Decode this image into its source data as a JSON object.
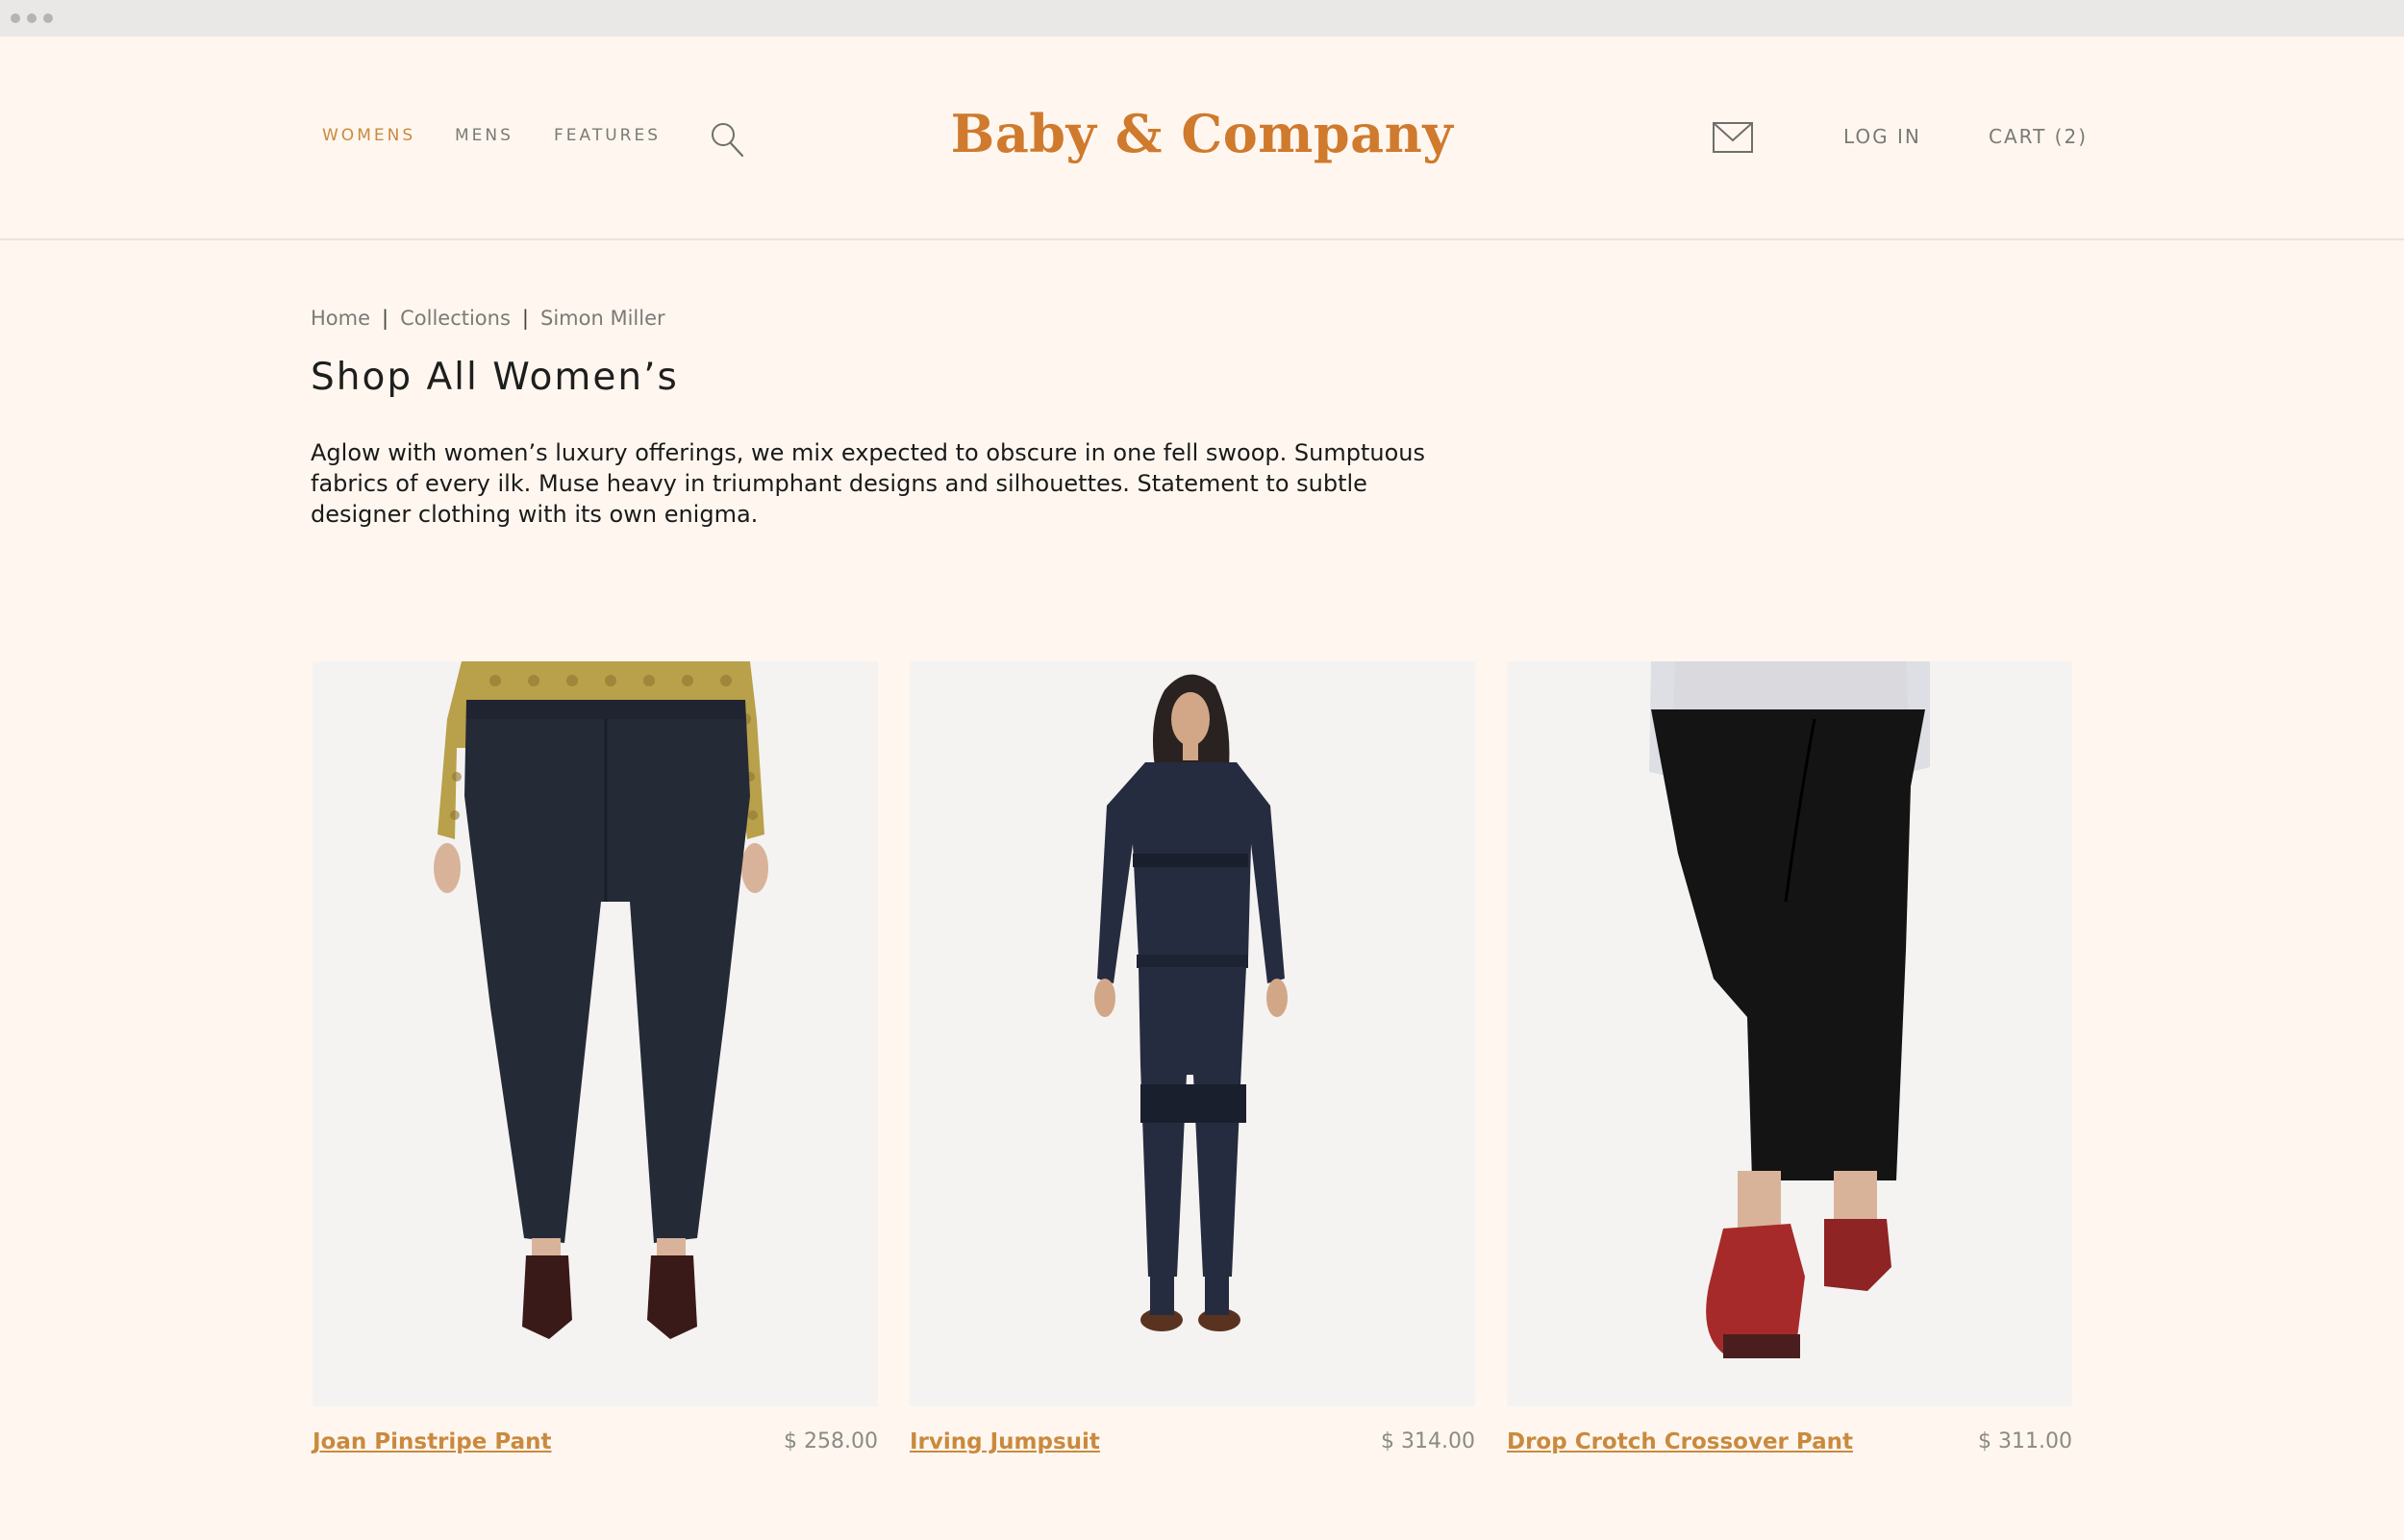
{
  "browser": {
    "controls": [
      "window-dot-icon",
      "window-dot-icon",
      "window-dot-icon"
    ]
  },
  "header": {
    "nav": [
      {
        "label": "WOMENS",
        "active": true
      },
      {
        "label": "MENS",
        "active": false
      },
      {
        "label": "FEATURES",
        "active": false
      }
    ],
    "search_icon": "search-icon",
    "logo": "Baby & Company",
    "mail_icon": "mail-icon",
    "login_label": "LOG IN",
    "cart_label": "CART (2)"
  },
  "breadcrumb": {
    "items": [
      "Home",
      "Collections",
      "Simon Miller"
    ],
    "separator": "|"
  },
  "page": {
    "title": "Shop All Women’s",
    "intro": "Aglow with women’s luxury offerings, we mix expected to obscure in one fell swoop. Sumptuous fabrics of every ilk. Muse heavy in triumphant designs and silhouettes. Statement to subtle designer clothing with its own enigma."
  },
  "products": [
    {
      "name": "Joan Pinstripe Pant",
      "price": "$ 258.00"
    },
    {
      "name": "Irving Jumpsuit",
      "price": "$ 314.00"
    },
    {
      "name": "Drop Crotch Crossover Pant",
      "price": "$ 311.00"
    }
  ],
  "colors": {
    "background": "#fff7ef",
    "accent": "#cf7a2d",
    "link": "#c98a3f",
    "muted": "#7a7a76"
  }
}
